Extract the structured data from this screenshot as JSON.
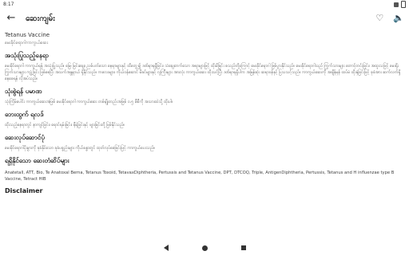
{
  "status_bar": {
    "time": "8:17"
  },
  "app_bar": {
    "back_icon": "←",
    "title": "ဆေးကျမ်း",
    "favorite_icon": "♡",
    "volume_icon": "🔈"
  },
  "content": {
    "english_title": "Tetanus Vaccine",
    "subtitle": "မေးခိုင်ရောဂါကာကွယ်ဆေး",
    "sections": [
      {
        "heading": "အသုံးပြုသည့်နေရာ",
        "body": "မေးခိုင်ရောဂါ ကာကွယ်ရန် အသုံးပြုသည်။ မြေ၊ မြင်းချေး၊ ညစ်ပတ်သော နေရာများနှင့် ထိတွေ့၍ ဒဏ်ရာရရှိခြင်း၊ သံချေးတက်သော အရာများဖြင့် ထိုးမိခြင်း စသည်တို့ကြောင့် မေးခိုင်ရောဂါ ဖြစ်ပွားနိုင်သည်။ မေးခိုင်ရောဂါသည် ကြွက်သားများ တောင့်တင်းခြင်း၊ အထူးသဖြင့် မေးရိုးကြွက်သားများ ကျုံ့ခြင်း ဖြစ်စေပြီး အသက်အန္တရာယ် ရှိနိုင်သည်။ ကလေးများ၊ ကိုယ်ဝန်ဆောင် မိခင်များနှင့် လူကြီးများ အားလုံး ကာကွယ်ဆေး ထိုးသင့်ပြီး ဒဏ်ရာရရှိပါက အမြန်ဆုံး ဆရာဝန်နှင့် ပြသသင့်သည်။ ကာကွယ်ဆေးကို အချိန်မှန် ထပ်မံ ထိုးနှံခြင်းဖြင့် ခုခံအား ဆက်လက်ရှိနေစေရန် လိုအပ်သည်။"
      },
      {
        "heading": "သုံးစွဲရန် ပမာဏ",
        "body": "သုံးကြိမ်ပေါင်း ကာကွယ်ဆေးအဖြစ် မေးခိုင်ရောဂါ ကာကွယ်ဆေး တစ်မျိုးတည်းအဖြစ် ၀.၅ စီစီကို အသားထဲသို့ ထိုးပါ။"
      },
      {
        "heading": "ဘေးထွက် ရလဒ်",
        "body": "ထိုးသည့်နေရာတွင် နာကျင်ခြင်း၊ ရောင်ရမ်းခြင်း၊ နီရဲခြင်းနှင့် ဖျားခြင်းတို့ ဖြစ်နိုင်သည်။"
      },
      {
        "heading": "ဆေးလုပ်ဆောင်ပုံ",
        "body": "မေးခိုင်ရောဂါပိုးမွှားကို ခုခံနိုင်သော ခုခံပစ္စည်းများ ကိုယ်ခန္ဓာတွင် ထုတ်လုပ်စေခြင်းဖြင့် ကာကွယ်ပေးသည်။"
      },
      {
        "heading": "ရရှိနိုင်သော ဆေးတံဆိပ်များ",
        "body": "Anatetall, ATT, Bio, Te Anatoxal Berna, Tetanus Toxoid, TetavaxDiphtheria, Pertussis and Tetanus Vaccine, DPT, DTCOQ, Triple, AntigenDiphtheria, Pertussis, Tetanus and H influenzae type B Vaccine, Tetract HIB"
      },
      {
        "heading": "Disclaimer",
        "body": ""
      }
    ]
  },
  "nav_bar": {
    "back_icon": "back-triangle",
    "home_icon": "home-circle",
    "recents_icon": "recents-square"
  }
}
